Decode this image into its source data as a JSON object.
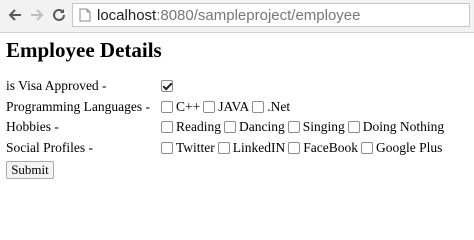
{
  "browser": {
    "url_host": "localhost",
    "url_rest": ":8080/sampleproject/employee"
  },
  "page": {
    "title": "Employee Details"
  },
  "form": {
    "visa": {
      "label": "is Visa Approved -",
      "checked": true
    },
    "languages": {
      "label": "Programming Languages -",
      "options": [
        "C++",
        "JAVA",
        ".Net"
      ]
    },
    "hobbies": {
      "label": "Hobbies -",
      "options": [
        "Reading",
        "Dancing",
        "Singing",
        "Doing Nothing"
      ]
    },
    "social": {
      "label": "Social Profiles -",
      "options": [
        "Twitter",
        "LinkedIN",
        "FaceBook",
        "Google Plus"
      ]
    },
    "submit_label": "Submit"
  }
}
